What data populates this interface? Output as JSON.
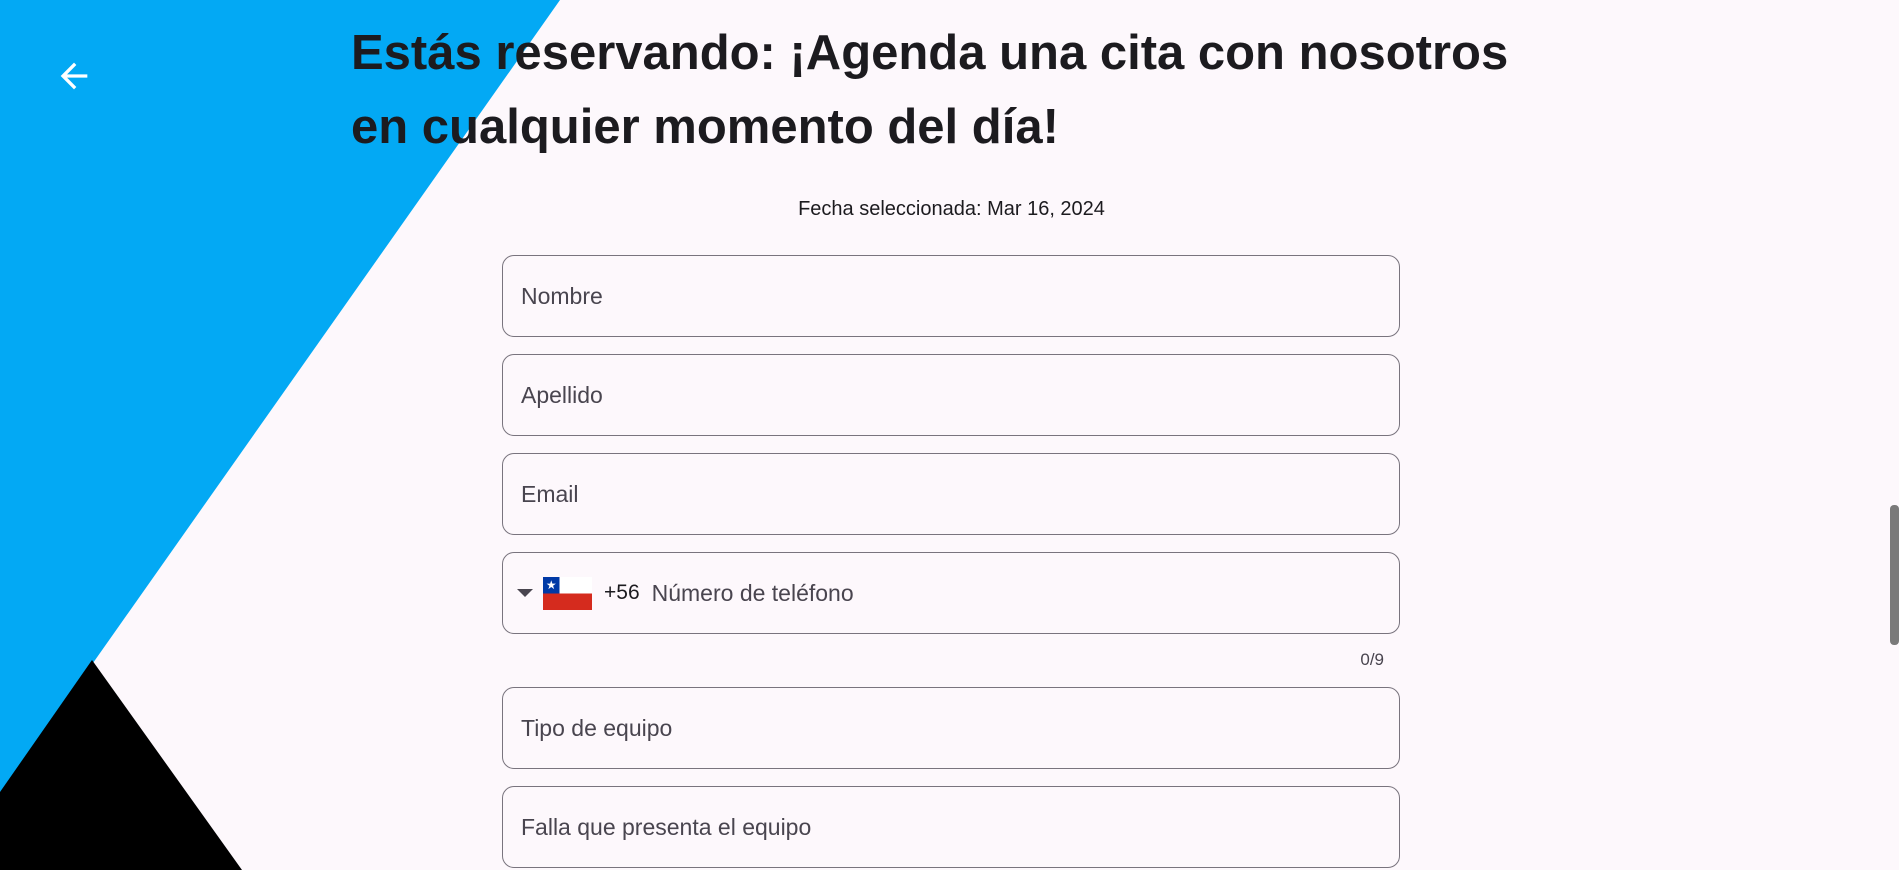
{
  "header": {
    "title": "Estás reservando: ¡Agenda una cita con nosotros en cualquier momento del día!",
    "back_icon": "arrow-left-icon"
  },
  "booking": {
    "selected_date": "Fecha seleccionada: Mar 16, 2024"
  },
  "form": {
    "nombre_placeholder": "Nombre",
    "apellido_placeholder": "Apellido",
    "email_placeholder": "Email",
    "phone": {
      "country_flag": "chile-flag-icon",
      "dial_code": "+56",
      "placeholder": "Número de teléfono",
      "counter": "0/9"
    },
    "tipo_equipo_placeholder": "Tipo de equipo",
    "falla_placeholder": "Falla que presenta el equipo"
  },
  "colors": {
    "background": "#FDF8FC",
    "accent_blue": "#03A9F4",
    "black_shape": "#000000",
    "field_border": "#79747E",
    "text_primary": "#1C1B1F"
  }
}
